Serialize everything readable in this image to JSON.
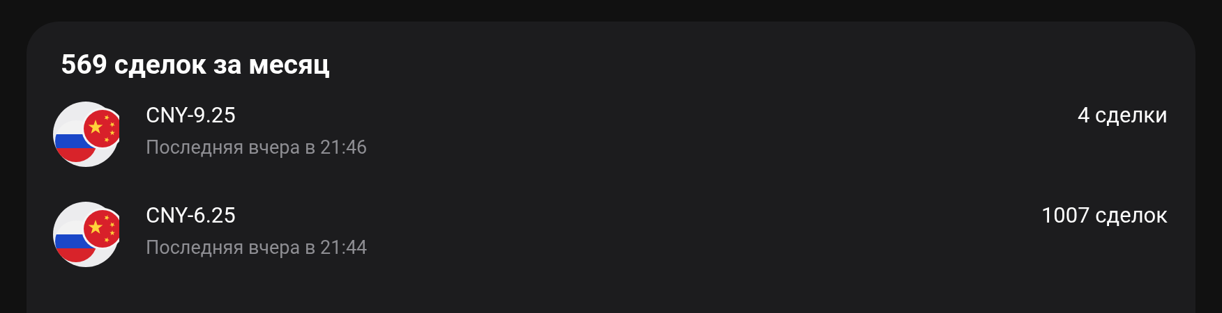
{
  "card": {
    "title": "569 сделок за месяц",
    "items": [
      {
        "name": "CNY-9.25",
        "subtitle": "Последняя вчера в 21:46",
        "count": "4 сделки"
      },
      {
        "name": "CNY-6.25",
        "subtitle": "Последняя вчера в 21:44",
        "count": "1007 сделок"
      }
    ]
  }
}
